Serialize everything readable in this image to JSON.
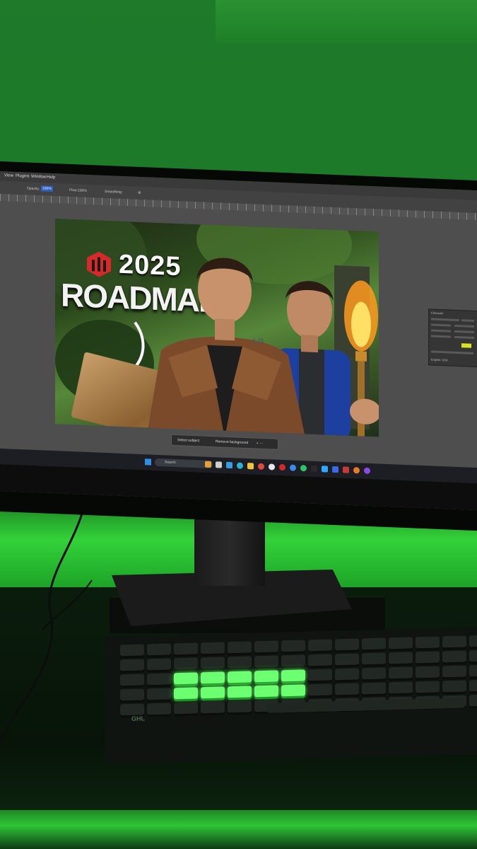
{
  "colors": {
    "wall": "#1f7a2a",
    "led_glow": "#33d23a",
    "screen_bg": "#4c4c4c",
    "accent_blue": "#2f5fbf",
    "key_backlight": "#6dff72",
    "logo_red": "#d42a2a",
    "swatch_yellow": "#d8e520"
  },
  "photoshop": {
    "menu": [
      "View",
      "Plugins",
      "Window",
      "Help"
    ],
    "options": {
      "opacity_label": "Opacity:",
      "opacity_value": "100%",
      "flow_label": "Flow:",
      "flow_value": "100%",
      "smoothing_label": "Smoothing:"
    },
    "context_bar": {
      "select_subject": "Select subject",
      "remove_background": "Remove background"
    },
    "character_panel": {
      "title": "Character",
      "language": "English: USA"
    }
  },
  "thumbnail": {
    "year": "2025",
    "title": "ROADMAP"
  },
  "taskbar": {
    "search_label": "Search",
    "icons": [
      "widgets-icon",
      "explorer-icon",
      "store-icon",
      "edge-icon",
      "folder-icon",
      "chrome-icon",
      "app-icon",
      "opera-icon",
      "chrome2-icon",
      "whatsapp-icon",
      "app2-icon",
      "app3-icon",
      "app4-icon",
      "app5-icon",
      "app6-icon",
      "app7-icon"
    ]
  },
  "monitor_brand": "LG",
  "keyboard_brand": "GHL"
}
